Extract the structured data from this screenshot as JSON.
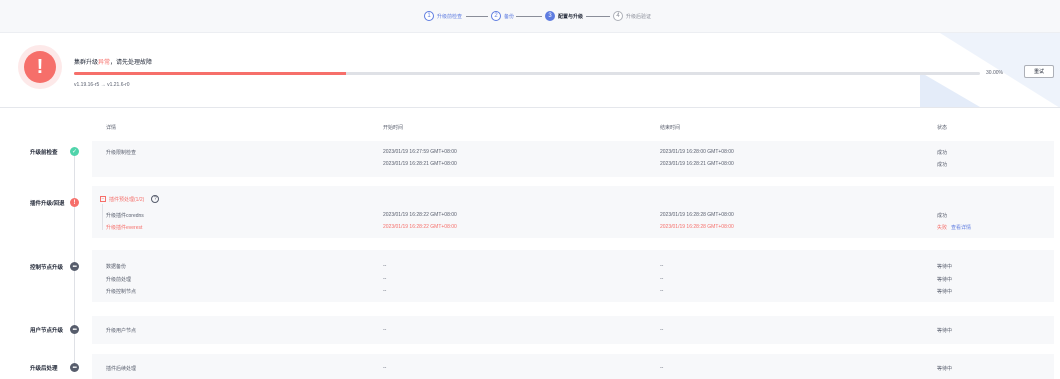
{
  "stepper": {
    "steps": [
      {
        "num": "1",
        "label": "升级前检查",
        "state": "done"
      },
      {
        "num": "2",
        "label": "备份",
        "state": "done"
      },
      {
        "num": "3",
        "label": "配置与升级",
        "state": "active"
      },
      {
        "num": "4",
        "label": "升级后验证",
        "state": "todo"
      }
    ]
  },
  "status": {
    "title_prefix": "集群升级",
    "title_error": "异常",
    "title_suffix": "，请先处理故障",
    "progress_percent": 30.0,
    "progress_label": "30.00%",
    "retry_label": "重试",
    "version": "v1.19.16-r5 → v1.21.6-r0"
  },
  "table": {
    "headers": [
      "详情",
      "开始时间",
      "结束时间",
      "状态"
    ]
  },
  "sections": [
    {
      "title": "升级前检查",
      "state": "ok",
      "rows": [
        {
          "detail": "升级限制检查",
          "start": "2023/01/19 16:27:59 GMT+08:00",
          "end": "2023/01/19 16:28:00 GMT+08:00",
          "status": "成功"
        },
        {
          "detail": "",
          "start": "2023/01/19 16:28:21 GMT+08:00",
          "end": "2023/01/19 16:28:21 GMT+08:00",
          "status": "成功"
        }
      ]
    },
    {
      "title": "插件升级/回退",
      "state": "error",
      "group_label": "插件预处理(1/2)",
      "rows": [
        {
          "detail": "升级插件coredns",
          "start": "2023/01/19 16:28:22 GMT+08:00",
          "end": "2023/01/19 16:28:28 GMT+08:00",
          "status": "成功",
          "fail": false
        },
        {
          "detail": "升级插件everest",
          "start": "2023/01/19 16:28:22 GMT+08:00",
          "end": "2023/01/19 16:28:28 GMT+08:00",
          "status": "失败",
          "link": "查看详情",
          "fail": true
        }
      ]
    },
    {
      "title": "控制节点升级",
      "state": "wait",
      "rows": [
        {
          "detail": "数据备份",
          "start": "--",
          "end": "--",
          "status": "等待中"
        },
        {
          "detail": "升级前处理",
          "start": "--",
          "end": "--",
          "status": "等待中"
        },
        {
          "detail": "升级控制节点",
          "start": "--",
          "end": "--",
          "status": "等待中"
        }
      ]
    },
    {
      "title": "用户节点升级",
      "state": "wait",
      "rows": [
        {
          "detail": "升级用户节点",
          "start": "--",
          "end": "--",
          "status": "等待中"
        }
      ]
    },
    {
      "title": "升级后处理",
      "state": "wait",
      "rows": [
        {
          "detail": "插件后续处理",
          "start": "--",
          "end": "--",
          "status": "等待中"
        }
      ]
    }
  ],
  "colors": {
    "error": "#f66f6a",
    "success": "#50d4ab",
    "brand": "#5e7ce0",
    "waiting": "#575d6c"
  }
}
